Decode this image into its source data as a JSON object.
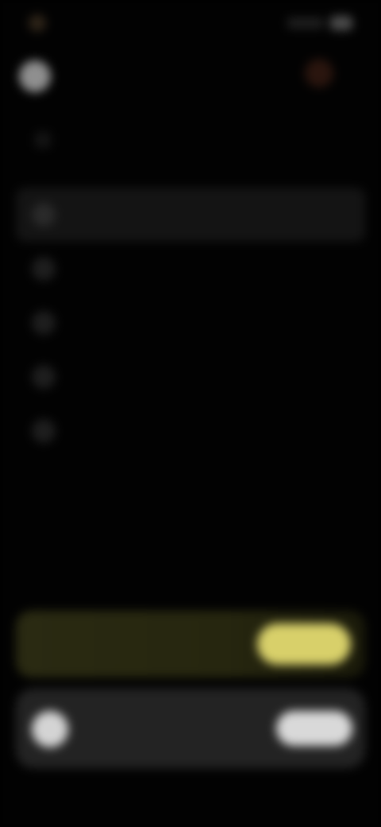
{
  "status_bar": {
    "time": "",
    "icons": [
      "app-dot-icon",
      "signal-icon",
      "battery-icon"
    ]
  },
  "profile": {
    "name": "",
    "notification_icon": "notification-icon",
    "avatar_icon": "avatar-icon"
  },
  "section": {
    "title": "",
    "back_icon": "back-arrow-icon"
  },
  "menu": {
    "items": [
      {
        "label": "",
        "icon": "menu-item-icon",
        "active": true
      },
      {
        "label": "",
        "icon": "menu-item-icon",
        "active": false
      },
      {
        "label": "",
        "icon": "menu-item-icon",
        "active": false
      },
      {
        "label": "",
        "icon": "menu-item-icon",
        "active": false
      },
      {
        "label": "",
        "icon": "menu-item-icon",
        "active": false
      }
    ]
  },
  "promo": {
    "text": "",
    "button_label": "",
    "accent_color": "#d8d06a"
  },
  "player": {
    "title": "",
    "subtitle": "",
    "button_label": ""
  },
  "colors": {
    "background": "#020202",
    "card": "#232323",
    "accent": "#d8d06a"
  }
}
